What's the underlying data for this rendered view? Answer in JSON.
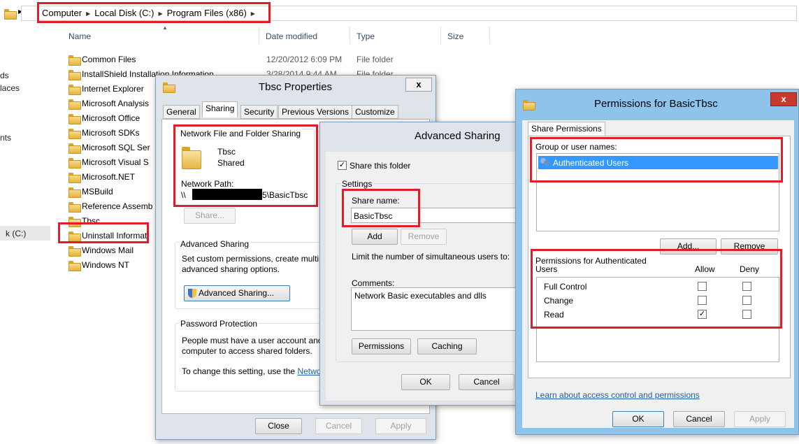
{
  "explorer": {
    "breadcrumb": [
      "Computer",
      "Local Disk (C:)",
      "Program Files (x86)"
    ],
    "columns": {
      "name": "Name",
      "date": "Date modified",
      "type": "Type",
      "size": "Size"
    },
    "nav_items": [
      "ds",
      "laces",
      "nts",
      "k (C:)"
    ],
    "files": [
      {
        "name": "Common Files",
        "date": "12/20/2012 6:09 PM",
        "type": "File folder"
      },
      {
        "name": "InstallShield Installation Information",
        "date": "3/28/2014 9:44 AM",
        "type": "File folder"
      },
      {
        "name": "Internet Explorer",
        "date": "",
        "type": ""
      },
      {
        "name": "Microsoft Analysis",
        "date": "",
        "type": ""
      },
      {
        "name": "Microsoft Office",
        "date": "",
        "type": ""
      },
      {
        "name": "Microsoft SDKs",
        "date": "",
        "type": ""
      },
      {
        "name": "Microsoft SQL Ser",
        "date": "",
        "type": ""
      },
      {
        "name": "Microsoft Visual S",
        "date": "",
        "type": ""
      },
      {
        "name": "Microsoft.NET",
        "date": "",
        "type": ""
      },
      {
        "name": "MSBuild",
        "date": "",
        "type": ""
      },
      {
        "name": "Reference Assemb",
        "date": "",
        "type": ""
      },
      {
        "name": "Tbsc",
        "date": "",
        "type": ""
      },
      {
        "name": "Uninstall Informat",
        "date": "",
        "type": ""
      },
      {
        "name": "Windows Mail",
        "date": "",
        "type": ""
      },
      {
        "name": "Windows NT",
        "date": "",
        "type": ""
      }
    ]
  },
  "props": {
    "title": "Tbsc Properties",
    "close": "x",
    "tabs": [
      "General",
      "Sharing",
      "Security",
      "Previous Versions",
      "Customize"
    ],
    "nfs_group": "Network File and Folder Sharing",
    "folder_name": "Tbsc",
    "folder_state": "Shared",
    "network_path_label": "Network Path:",
    "network_path_prefix": "\\\\",
    "network_path_suffix": "5\\BasicTbsc",
    "share_button": "Share...",
    "adv_group": "Advanced Sharing",
    "adv_desc_1": "Set custom permissions, create multiple",
    "adv_desc_2": "advanced sharing options.",
    "adv_button": "Advanced Sharing...",
    "pw_group": "Password Protection",
    "pw_desc_1": "People must have a user account and",
    "pw_desc_2": "computer to access shared folders.",
    "pw_desc_3": "To change this setting, use the",
    "pw_link": "Netwo",
    "close_button": "Close",
    "cancel_button": "Cancel",
    "apply_button": "Apply"
  },
  "adv": {
    "title": "Advanced Sharing",
    "share_checkbox": "Share this folder",
    "share_checked": true,
    "settings_group": "Settings",
    "share_name_label": "Share name:",
    "share_name_value": "BasicTbsc",
    "add_button": "Add",
    "remove_button": "Remove",
    "limit_label": "Limit the number of simultaneous users to:",
    "comments_label": "Comments:",
    "comments_value": "Network Basic executables and dlls",
    "permissions_button": "Permissions",
    "caching_button": "Caching",
    "ok_button": "OK",
    "cancel_button": "Cancel"
  },
  "perm": {
    "title": "Permissions for BasicTbsc",
    "close": "x",
    "tab": "Share Permissions",
    "group_label": "Group or user names:",
    "users": [
      "Authenticated Users"
    ],
    "add_button": "Add...",
    "remove_button": "Remove",
    "perm_for_1": "Permissions for Authenticated",
    "perm_for_2": "Users",
    "allow": "Allow",
    "deny": "Deny",
    "rows": [
      {
        "name": "Full Control",
        "allow": false,
        "deny": false
      },
      {
        "name": "Change",
        "allow": false,
        "deny": false
      },
      {
        "name": "Read",
        "allow": true,
        "deny": false
      }
    ],
    "link": "Learn about access control and permissions",
    "ok_button": "OK",
    "cancel_button": "Cancel",
    "apply_button": "Apply"
  },
  "colors": {
    "highlight": "#e11d2a",
    "selection": "#3399ff",
    "window_frame": "#8ec3ec"
  }
}
